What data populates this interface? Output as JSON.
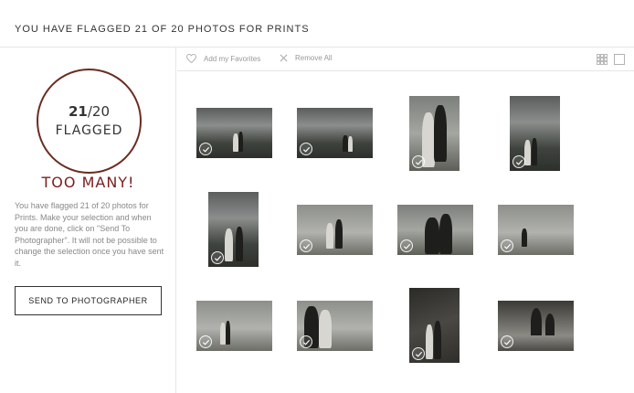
{
  "header": {
    "title": "YOU HAVE FLAGGED 21 OF 20 PHOTOS FOR PRINTS"
  },
  "sidebar": {
    "count_selected": "21",
    "count_separator": "/",
    "count_limit": "20",
    "flagged_label": "FLAGGED",
    "warning": "TOO MANY!",
    "description": "You have flagged 21 of 20 photos for Prints. Make your selection and when you are done, click on \"Send To Photographer\". It will not be possible to change the selection once you have sent it.",
    "send_button": "SEND TO PHOTOGRAPHER"
  },
  "toolbar": {
    "add_favorites": "Add my Favorites",
    "remove_all": "Remove All"
  },
  "colors": {
    "accent": "#6b2d22",
    "warning": "#7a1f1f"
  },
  "icons": [
    "heart-icon",
    "close-icon",
    "grid-view-icon",
    "single-view-icon",
    "check-icon"
  ]
}
